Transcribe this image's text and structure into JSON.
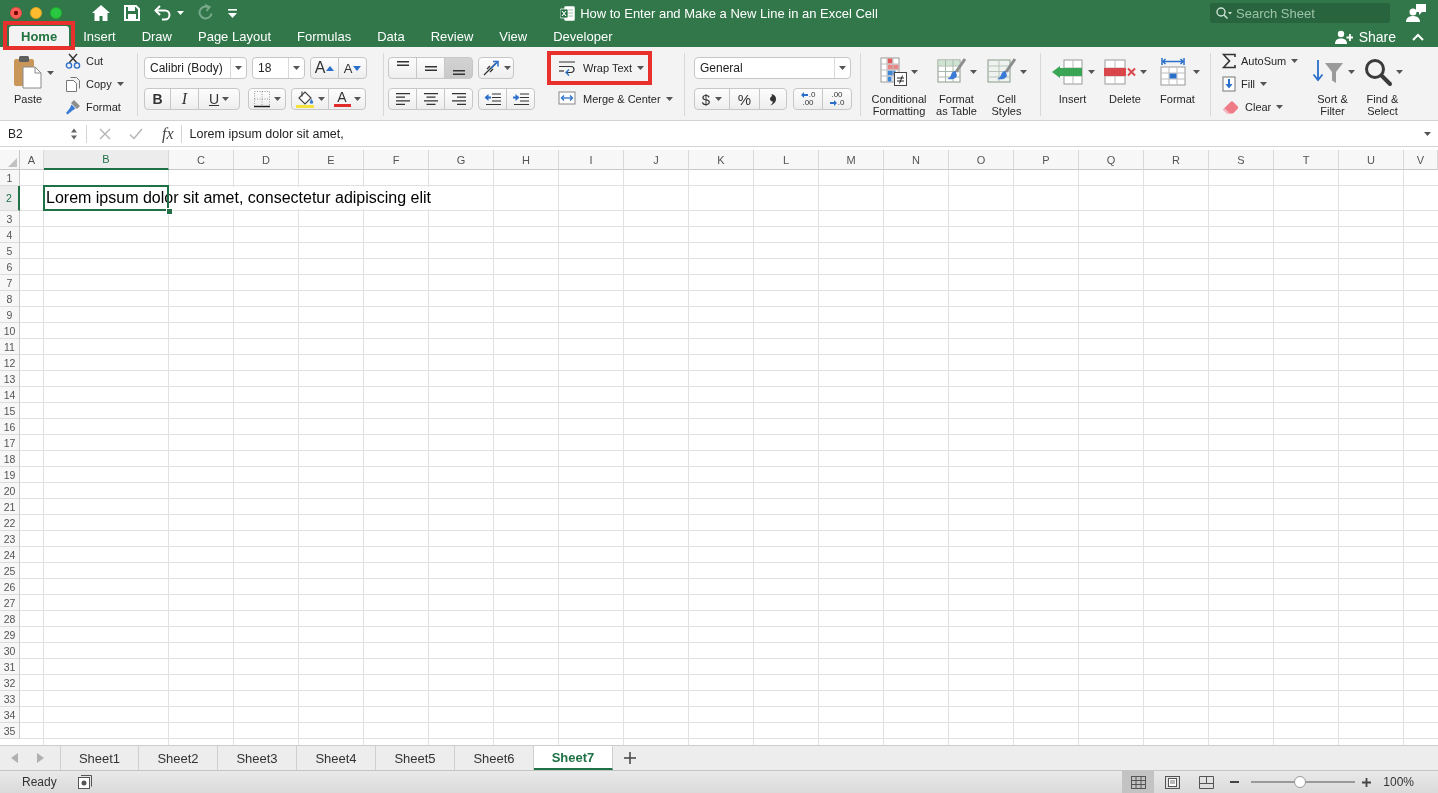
{
  "window": {
    "title": "How to Enter and Make a New Line in an Excel Cell",
    "search": {
      "placeholder": "Search Sheet"
    }
  },
  "quick_access": [
    {
      "kind": "home",
      "disabled": false
    },
    {
      "kind": "save",
      "disabled": false
    },
    {
      "kind": "undo",
      "disabled": false
    },
    {
      "kind": "redo",
      "disabled": true
    },
    {
      "kind": "customize",
      "disabled": false
    }
  ],
  "tabs": [
    {
      "label": "Home",
      "selected": true,
      "highlighted": true
    },
    {
      "label": "Insert",
      "selected": false,
      "highlighted": false
    },
    {
      "label": "Draw",
      "selected": false,
      "highlighted": false
    },
    {
      "label": "Page Layout",
      "selected": false,
      "highlighted": false
    },
    {
      "label": "Formulas",
      "selected": false,
      "highlighted": false
    },
    {
      "label": "Data",
      "selected": false,
      "highlighted": false
    },
    {
      "label": "Review",
      "selected": false,
      "highlighted": false
    },
    {
      "label": "View",
      "selected": false,
      "highlighted": false
    },
    {
      "label": "Developer",
      "selected": false,
      "highlighted": false
    }
  ],
  "share": {
    "label": "Share"
  },
  "ribbon": {
    "clipboard": {
      "paste": {
        "label": "Paste"
      },
      "items": [
        {
          "kind": "cut",
          "label": "Cut",
          "dropdown": false
        },
        {
          "kind": "copy",
          "label": "Copy",
          "dropdown": true
        },
        {
          "kind": "format-painter",
          "label": "Format",
          "dropdown": false
        }
      ]
    },
    "font": {
      "name": "Calibri (Body)",
      "size": "18",
      "size_buttons": [
        {
          "kind": "grow",
          "glyph": "A"
        },
        {
          "kind": "shrink",
          "glyph": "A"
        }
      ],
      "style_buttons": [
        {
          "kind": "bold",
          "glyph": "B"
        },
        {
          "kind": "italic",
          "glyph": "I"
        },
        {
          "kind": "underline",
          "glyph": "U"
        }
      ],
      "font_color": {
        "glyph": "A"
      }
    },
    "alignment": {
      "vertical": [
        {
          "kind": "top",
          "selected": false
        },
        {
          "kind": "middle",
          "selected": false
        },
        {
          "kind": "bottom",
          "selected": true
        }
      ],
      "horizontal": [
        {
          "kind": "left",
          "selected": false
        },
        {
          "kind": "center",
          "selected": false
        },
        {
          "kind": "right",
          "selected": false
        }
      ],
      "buttons": [
        {
          "kind": "wrap",
          "label": "Wrap Text",
          "highlighted": true
        },
        {
          "kind": "merge",
          "label": "Merge & Center",
          "highlighted": false
        }
      ]
    },
    "number": {
      "format": "General",
      "buttons": [
        {
          "kind": "currency",
          "glyph": "$"
        },
        {
          "kind": "percent",
          "glyph": "%"
        },
        {
          "kind": "comma"
        }
      ],
      "decimals": [
        {
          "kind": "increase",
          "top": ".0",
          "bottom": ".00"
        },
        {
          "kind": "decrease",
          "top": ".00",
          "bottom": ".0"
        }
      ]
    },
    "styles": [
      {
        "kind": "conditional",
        "label": "Conditional\nFormatting"
      },
      {
        "kind": "table",
        "label": "Format\nas Table"
      },
      {
        "kind": "cell-styles",
        "label": "Cell\nStyles"
      }
    ],
    "cells": [
      {
        "kind": "insert",
        "label": "Insert"
      },
      {
        "kind": "delete",
        "label": "Delete"
      },
      {
        "kind": "format",
        "label": "Format"
      }
    ],
    "editing": {
      "small": [
        {
          "kind": "autosum",
          "label": "AutoSum"
        },
        {
          "kind": "fill",
          "label": "Fill"
        },
        {
          "kind": "clear",
          "label": "Clear"
        }
      ],
      "large": [
        {
          "kind": "sort",
          "label": "Sort &\nFilter"
        },
        {
          "kind": "find",
          "label": "Find &\nSelect"
        }
      ]
    }
  },
  "formula_bar": {
    "name_box": "B2",
    "function_label": "fx",
    "value": "Lorem ipsum dolor sit amet,"
  },
  "sheet": {
    "columns": [
      {
        "label": "A",
        "selected": false
      },
      {
        "label": "B",
        "selected": true
      },
      {
        "label": "C",
        "selected": false
      },
      {
        "label": "D",
        "selected": false
      },
      {
        "label": "E",
        "selected": false
      },
      {
        "label": "F",
        "selected": false
      },
      {
        "label": "G",
        "selected": false
      },
      {
        "label": "H",
        "selected": false
      },
      {
        "label": "I",
        "selected": false
      },
      {
        "label": "J",
        "selected": false
      },
      {
        "label": "K",
        "selected": false
      },
      {
        "label": "L",
        "selected": false
      },
      {
        "label": "M",
        "selected": false
      },
      {
        "label": "N",
        "selected": false
      },
      {
        "label": "O",
        "selected": false
      },
      {
        "label": "P",
        "selected": false
      },
      {
        "label": "Q",
        "selected": false
      },
      {
        "label": "R",
        "selected": false
      },
      {
        "label": "S",
        "selected": false
      },
      {
        "label": "T",
        "selected": false
      },
      {
        "label": "U",
        "selected": false
      },
      {
        "label": "V",
        "selected": false
      }
    ],
    "rows": [
      {
        "label": "1",
        "selected": false
      },
      {
        "label": "2",
        "selected": true
      },
      {
        "label": "3",
        "selected": false
      },
      {
        "label": "4",
        "selected": false
      },
      {
        "label": "5",
        "selected": false
      },
      {
        "label": "6",
        "selected": false
      },
      {
        "label": "7",
        "selected": false
      },
      {
        "label": "8",
        "selected": false
      },
      {
        "label": "9",
        "selected": false
      },
      {
        "label": "10",
        "selected": false
      },
      {
        "label": "11",
        "selected": false
      },
      {
        "label": "12",
        "selected": false
      },
      {
        "label": "13",
        "selected": false
      },
      {
        "label": "14",
        "selected": false
      },
      {
        "label": "15",
        "selected": false
      },
      {
        "label": "16",
        "selected": false
      },
      {
        "label": "17",
        "selected": false
      },
      {
        "label": "18",
        "selected": false
      },
      {
        "label": "19",
        "selected": false
      },
      {
        "label": "20",
        "selected": false
      },
      {
        "label": "21",
        "selected": false
      },
      {
        "label": "22",
        "selected": false
      },
      {
        "label": "23",
        "selected": false
      },
      {
        "label": "24",
        "selected": false
      },
      {
        "label": "25",
        "selected": false
      },
      {
        "label": "26",
        "selected": false
      },
      {
        "label": "27",
        "selected": false
      },
      {
        "label": "28",
        "selected": false
      },
      {
        "label": "29",
        "selected": false
      },
      {
        "label": "30",
        "selected": false
      },
      {
        "label": "31",
        "selected": false
      },
      {
        "label": "32",
        "selected": false
      },
      {
        "label": "33",
        "selected": false
      },
      {
        "label": "34",
        "selected": false
      },
      {
        "label": "35",
        "selected": false
      }
    ],
    "active_cell": {
      "text": "Lorem ipsum dolor sit amet, consectetur adipiscing elit"
    }
  },
  "sheet_tabs": [
    {
      "label": "Sheet1",
      "selected": false
    },
    {
      "label": "Sheet2",
      "selected": false
    },
    {
      "label": "Sheet3",
      "selected": false
    },
    {
      "label": "Sheet4",
      "selected": false
    },
    {
      "label": "Sheet5",
      "selected": false
    },
    {
      "label": "Sheet6",
      "selected": false
    },
    {
      "label": "Sheet7",
      "selected": true
    }
  ],
  "status_bar": {
    "mode": "Ready",
    "views": [
      {
        "kind": "normal",
        "selected": true
      },
      {
        "kind": "page-layout",
        "selected": false
      },
      {
        "kind": "page-break",
        "selected": false
      }
    ],
    "zoom": {
      "level": 0.47,
      "label": "100%"
    }
  }
}
